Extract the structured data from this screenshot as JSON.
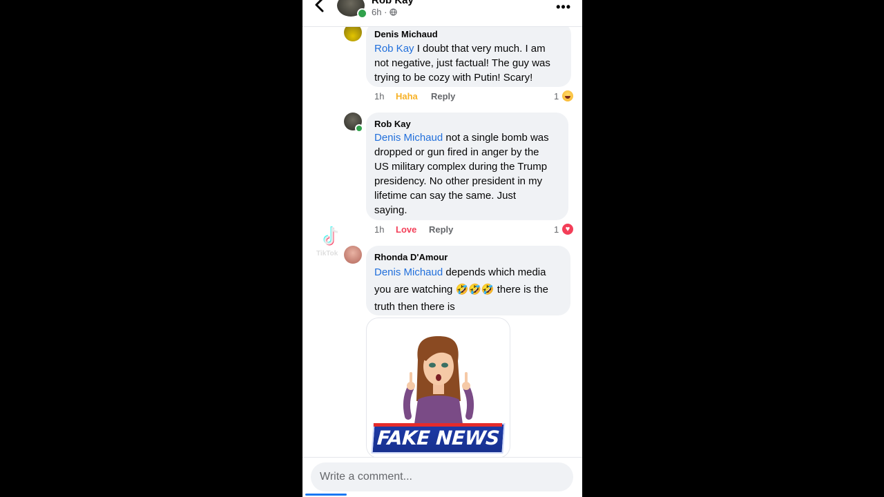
{
  "header": {
    "name": "Rob Kay",
    "time": "6h · ",
    "audience_icon": "globe-icon",
    "more_icon": "more-dots-icon",
    "back_icon": "back-chevron-icon"
  },
  "comments": [
    {
      "author": "Denis Michaud",
      "mention": "Rob Kay",
      "lines": [
        " I doubt that very much. I am",
        "not negative, just factual! The guy was",
        "trying to be cozy with Putin! Scary!"
      ],
      "time": "1h",
      "reaction_label": "Haha",
      "reply_label": "Reply",
      "reaction_count": "1",
      "reaction_icon": "haha-emoji-icon"
    },
    {
      "author": "Rob Kay",
      "mention": "Denis Michaud",
      "lines": [
        " not a single bomb was",
        "dropped or gun fired in anger by the",
        "US military complex during the Trump",
        "presidency.  No other president in my",
        "lifetime can say the same.  Just",
        "saying."
      ],
      "time": "1h",
      "reaction_label": "Love",
      "reply_label": "Reply",
      "reaction_count": "1",
      "reaction_icon": "love-heart-icon"
    },
    {
      "author": "Rhonda D'Amour",
      "mention": "Denis Michaud",
      "lines": [
        " depends which media",
        "you are watching 🤣🤣🤣 there is the",
        "truth then there is"
      ],
      "sticker_text": "FAKE NEWS"
    }
  ],
  "watermark": {
    "brand": "TikTok"
  },
  "composer": {
    "placeholder": "Write a comment..."
  },
  "colors": {
    "mention": "#216fdb",
    "haha": "#f7b125",
    "love": "#f33e58",
    "bubble": "#f0f2f5"
  }
}
